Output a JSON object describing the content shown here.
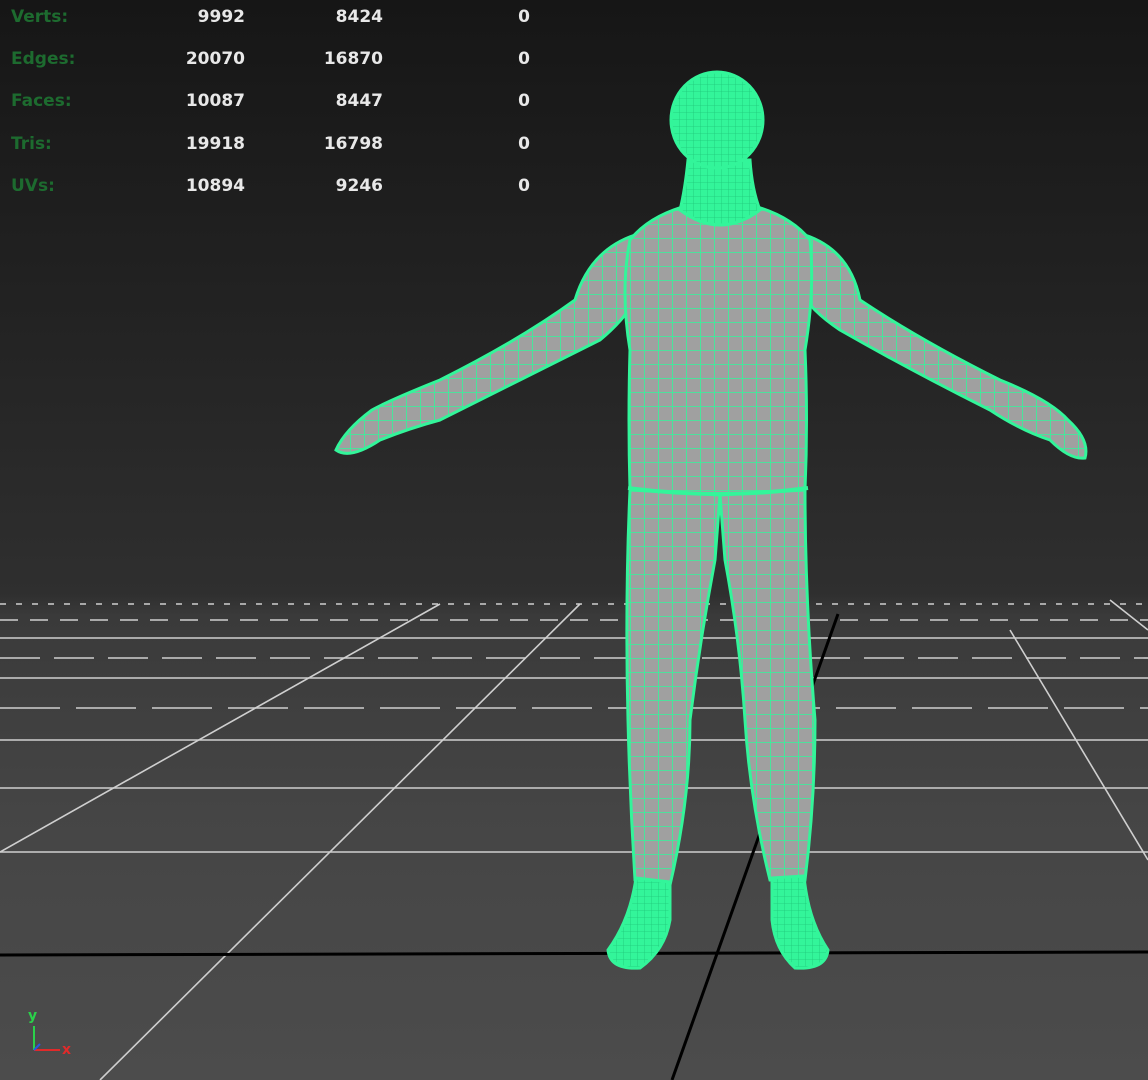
{
  "stats": {
    "rows": [
      {
        "label": "Verts:",
        "v1": "9992",
        "v2": "8424",
        "v3": "0"
      },
      {
        "label": "Edges:",
        "v1": "20070",
        "v2": "16870",
        "v3": "0"
      },
      {
        "label": "Faces:",
        "v1": "10087",
        "v2": "8447",
        "v3": "0"
      },
      {
        "label": "Tris:",
        "v1": "19918",
        "v2": "16798",
        "v3": "0"
      },
      {
        "label": "UVs:",
        "v1": "10894",
        "v2": "9246",
        "v3": "0"
      }
    ]
  },
  "axis": {
    "y_label": "y",
    "x_label": "x"
  },
  "colors": {
    "wireframe": "#33f59a",
    "mesh_fill": "#9a9a9a",
    "stat_label": "#1d6b2f",
    "stat_value": "#e8e8e8",
    "grid_line": "#cfcfcf",
    "axis_x": "#e02a2a",
    "axis_y": "#2ad14a",
    "axis_z": "#2a56e0"
  }
}
